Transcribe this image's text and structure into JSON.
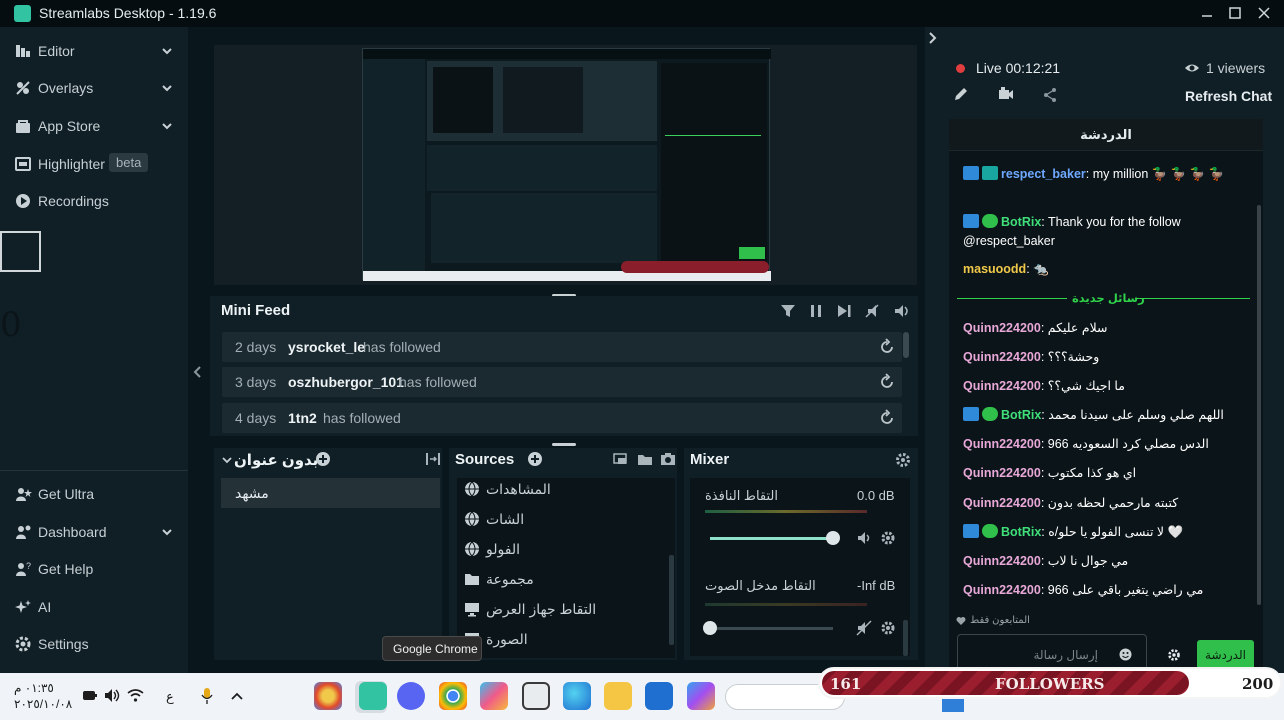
{
  "window": {
    "title": "Streamlabs Desktop - 1.19.6"
  },
  "sidebar": {
    "top_items": [
      {
        "label": "Editor",
        "icon": "editor-icon"
      },
      {
        "label": "Overlays",
        "icon": "overlays-icon"
      },
      {
        "label": "App Store",
        "icon": "app-store-icon"
      },
      {
        "label": "Highlighter",
        "icon": "highlighter-icon",
        "badge": "beta"
      },
      {
        "label": "Recordings",
        "icon": "recordings-icon"
      }
    ],
    "bottom_items": [
      {
        "label": "Get Ultra",
        "icon": "ultra-icon"
      },
      {
        "label": "Dashboard",
        "icon": "dashboard-icon"
      },
      {
        "label": "Get Help",
        "icon": "help-icon"
      },
      {
        "label": "AI",
        "icon": "ai-icon"
      },
      {
        "label": "Settings",
        "icon": "settings-icon"
      }
    ],
    "zero_glyph": "0"
  },
  "minifeed": {
    "title": "Mini Feed",
    "rows": [
      {
        "age": "2 days",
        "name": "ysrocket_le",
        "action": "has followed"
      },
      {
        "age": "3 days",
        "name": "oszhubergor_101",
        "action": "has followed"
      },
      {
        "age": "4 days",
        "name": "1tn2",
        "action": "has followed"
      }
    ]
  },
  "scenes": {
    "title": "بدون عنوان",
    "items": [
      "مشهد"
    ]
  },
  "sources": {
    "title": "Sources",
    "items": [
      {
        "label": "المشاهدات",
        "icon": "globe-icon"
      },
      {
        "label": "الشات",
        "icon": "globe-icon"
      },
      {
        "label": "الفولو",
        "icon": "globe-icon"
      },
      {
        "label": "مجموعة",
        "icon": "folder-icon"
      },
      {
        "label": "التقاط جهاز العرض",
        "icon": "monitor-icon"
      },
      {
        "label": "الصورة",
        "icon": "image-icon"
      }
    ]
  },
  "mixer": {
    "title": "Mixer",
    "channels": [
      {
        "name": "التقاط النافذة",
        "level": "0.0 dB",
        "volume": 1.0
      },
      {
        "name": "التقاط مدخل الصوت",
        "level": "-Inf dB",
        "volume": 0.0
      }
    ]
  },
  "chat": {
    "live_label": "Live 00:12:21",
    "viewers": "1 viewers",
    "refresh": "Refresh Chat",
    "header": "الدردشة",
    "messages": [
      {
        "user": "respect_baker",
        "text": ": my million 🦆 🦆 🦆 🦆",
        "color": "#6ea8ff"
      },
      {
        "user": "BotRix",
        "text": ": Thank you for the follow",
        "color": "#3fe07a"
      },
      {
        "user": "",
        "text": "@respect_baker",
        "color": "#ffffff"
      },
      {
        "user": "masuoodd",
        "text": ": 🐀",
        "color": "#f1c94a"
      },
      {
        "user": "Quinn224200",
        "text": ": سلام عليكم",
        "color": "#e8a8d8"
      },
      {
        "user": "Quinn224200",
        "text": ": وحشة؟؟؟",
        "color": "#e8a8d8"
      },
      {
        "user": "Quinn224200",
        "text": ": ما اجيك شي؟؟",
        "color": "#e8a8d8"
      },
      {
        "user": "BotRix",
        "text": ": اللهم صلي وسلم على سيدنا محمد",
        "color": "#3fe07a"
      },
      {
        "user": "Quinn224200",
        "text": ": الدس مصلي كرد السعوديه 966",
        "color": "#e8a8d8"
      },
      {
        "user": "Quinn224200",
        "text": ": اي هو كذا مكتوب",
        "color": "#e8a8d8"
      },
      {
        "user": "Quinn224200",
        "text": ": كتبته مارحمي لحظه بدون",
        "color": "#e8a8d8"
      },
      {
        "user": "BotRix",
        "text": ": لا تنسى الفولو يا حلو/ه 🤍",
        "color": "#3fe07a"
      },
      {
        "user": "Quinn224200",
        "text": ": مي جوال نا لاب",
        "color": "#e8a8d8"
      },
      {
        "user": "Quinn224200",
        "text": ": مي راضي يتغير باقي على 966",
        "color": "#e8a8d8"
      }
    ],
    "new_messages": "رسائل جديدة",
    "followers_only": "المتابعون فقط",
    "input_placeholder": "إرسال رسالة",
    "send_label": "الدردشة"
  },
  "overlay_bar": {
    "current": "161",
    "label": "FOLLOWERS",
    "goal": "200",
    "progress": 0.805
  },
  "taskbar": {
    "time": "٠١:٣٥ م",
    "date": "٢٠٢٥/١٠/٠٨",
    "lang": "ع",
    "tooltip": "Google Chrome"
  },
  "colors": {
    "accent": "#31c3a2",
    "live": "#e03e3e",
    "bg": "#09161b",
    "panel": "#0f1f25"
  }
}
